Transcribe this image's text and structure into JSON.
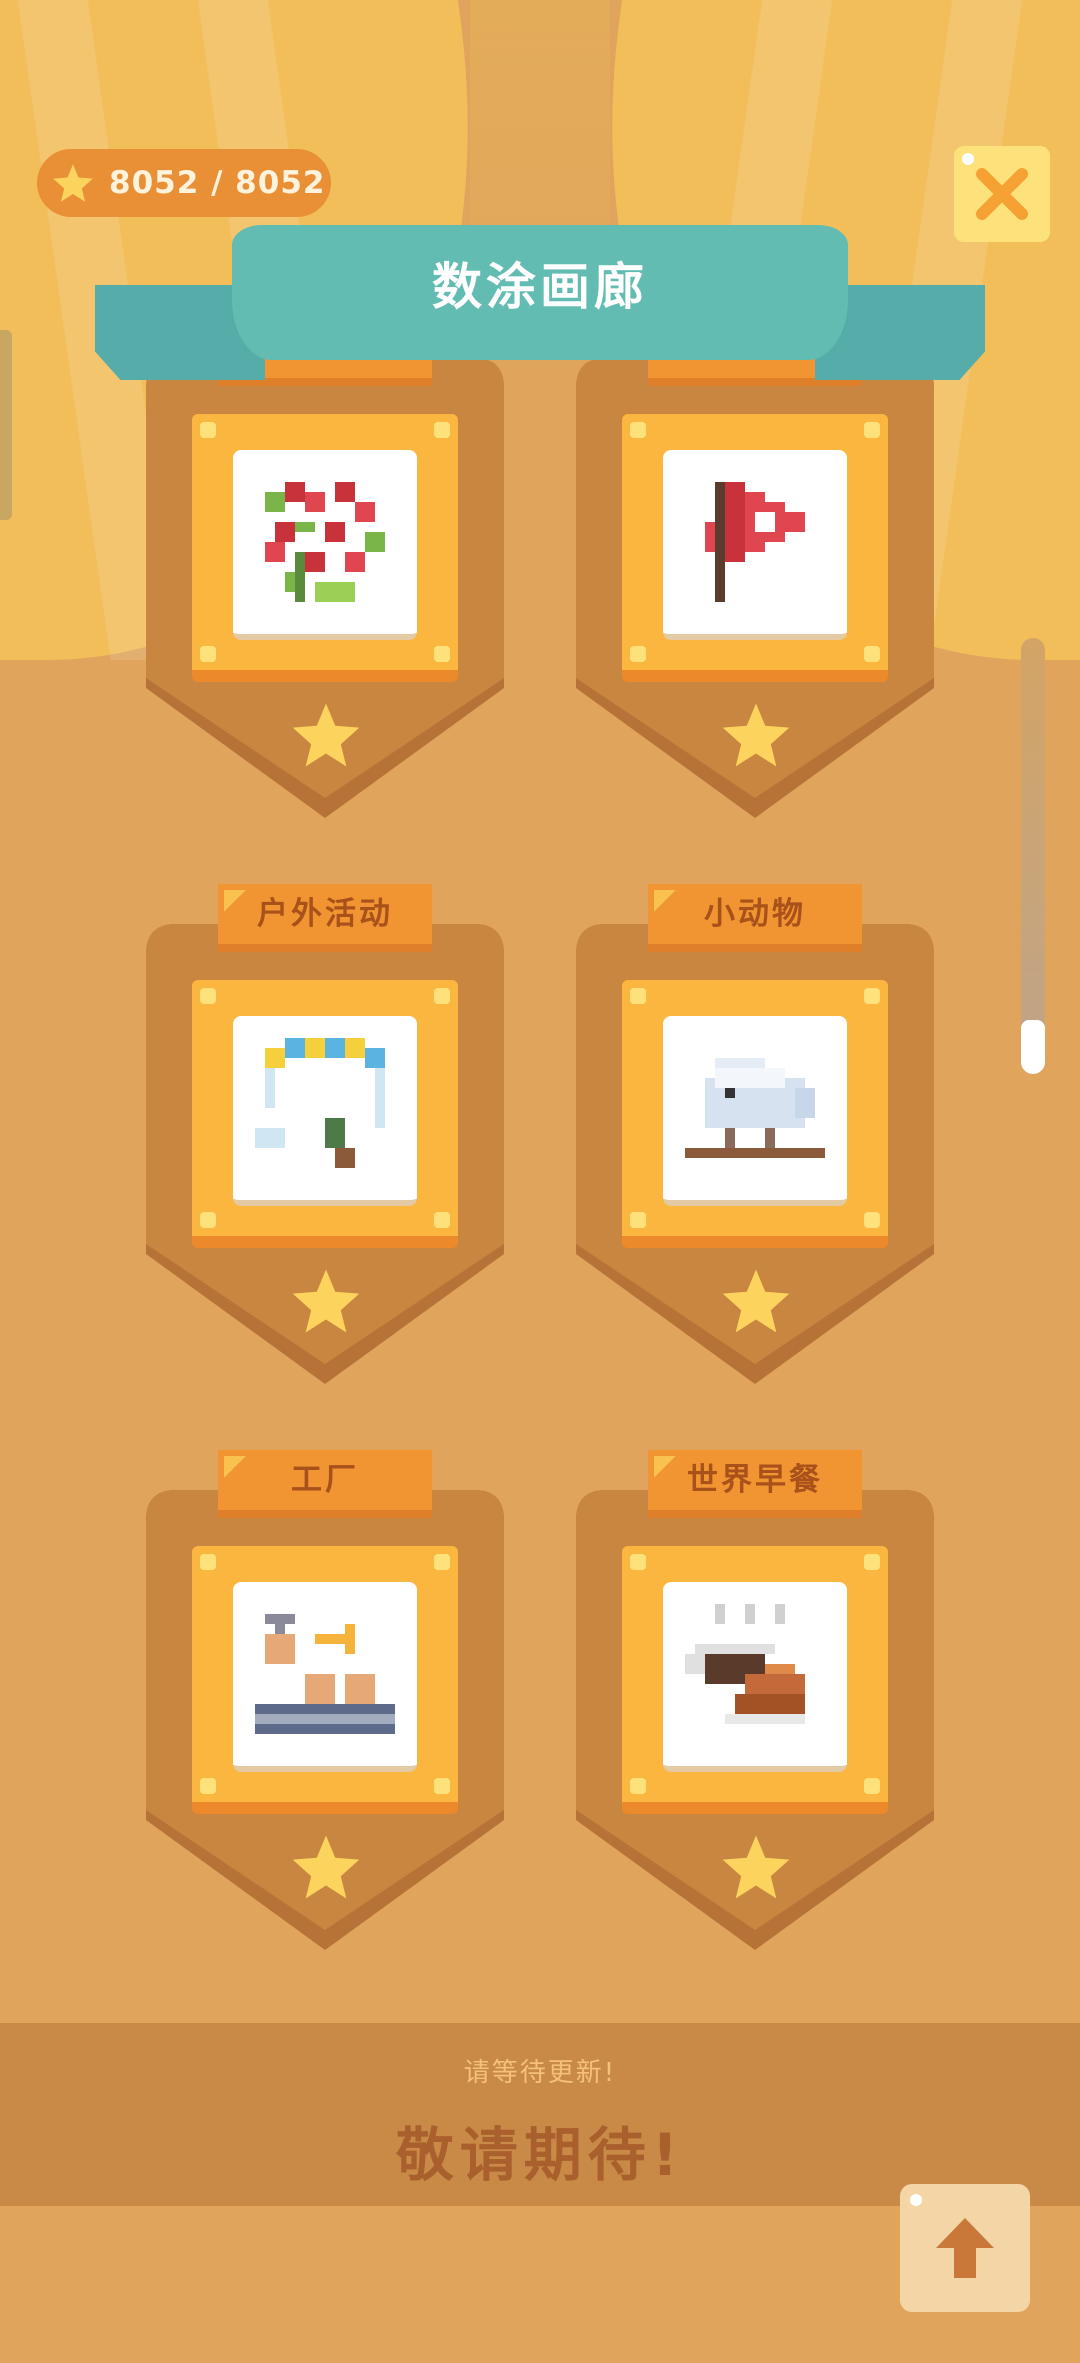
{
  "header": {
    "score_text": "8052 / 8052",
    "title": "数涂画廊",
    "close_icon": "close-icon"
  },
  "categories": [
    {
      "label": "",
      "picture": "flowering-branch-pixel-art"
    },
    {
      "label": "",
      "picture": "red-heart-flag-pixel-art"
    },
    {
      "label": "户外活动",
      "picture": "paraglider-pixel-art"
    },
    {
      "label": "小动物",
      "picture": "white-bird-on-branch-pixel-art"
    },
    {
      "label": "工厂",
      "picture": "factory-conveyor-pixel-art"
    },
    {
      "label": "世界早餐",
      "picture": "coffee-and-croissant-pixel-art"
    }
  ],
  "footer": {
    "subtitle": "请等待更新!",
    "message": "敬请期待!"
  },
  "colors": {
    "background": "#e0a45d",
    "curtain": "#f1be5a",
    "ribbon": "#62bcb2",
    "card_shield": "#c37d3e",
    "frame": "#fbb63f",
    "tag": "#f09532",
    "star": "#fbd35d"
  }
}
